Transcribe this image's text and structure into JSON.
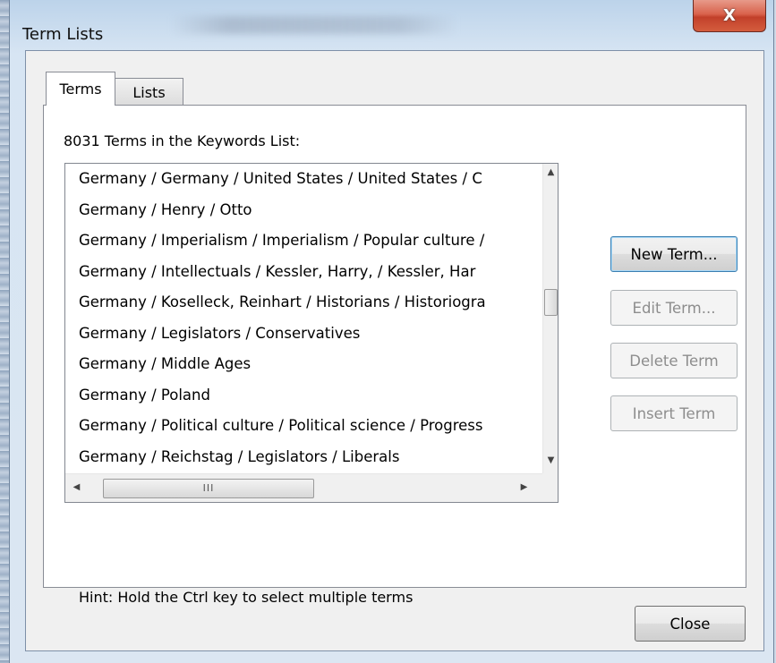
{
  "window": {
    "title": "Term Lists",
    "close_glyph": "X"
  },
  "tabs": [
    {
      "label": "Terms",
      "selected": true
    },
    {
      "label": "Lists",
      "selected": false
    }
  ],
  "terms": {
    "count_label": "8031 Terms in the Keywords List:",
    "items": [
      "Germany / Germany / United States / United States / C",
      "Germany / Henry / Otto",
      "Germany / Imperialism / Imperialism / Popular culture /",
      "Germany / Intellectuals / Kessler, Harry, / Kessler, Har",
      "Germany / Koselleck, Reinhart / Historians / Historiogra",
      "Germany / Legislators / Conservatives",
      "Germany / Middle Ages",
      "Germany / Poland",
      "Germany / Political culture / Political science / Progress",
      "Germany / Reichstag / Legislators / Liberals"
    ],
    "hscroll_grip": "III",
    "hint": "Hint: Hold the Ctrl key to select multiple terms"
  },
  "buttons": {
    "new_term": "New Term...",
    "edit_term": "Edit Term...",
    "delete_term": "Delete Term",
    "insert_term": "Insert Term",
    "close": "Close"
  },
  "icons": {
    "scroll_up": "scroll-up-arrow-icon",
    "scroll_down": "scroll-down-arrow-icon",
    "scroll_left": "scroll-left-arrow-icon",
    "scroll_right": "scroll-right-arrow-icon",
    "close": "close-icon"
  }
}
